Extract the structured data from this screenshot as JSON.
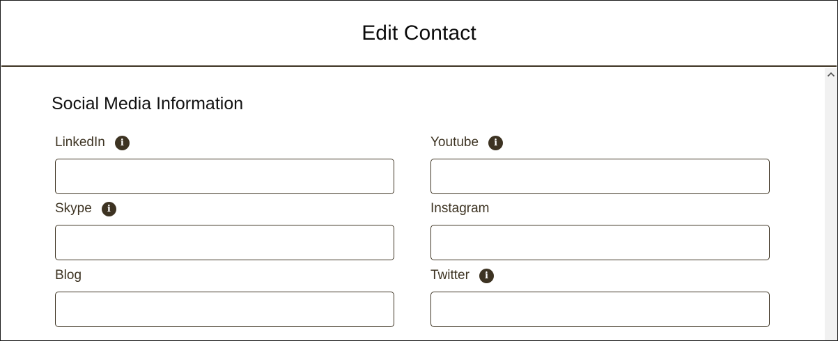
{
  "modal": {
    "title": "Edit Contact"
  },
  "section": {
    "heading": "Social Media Information"
  },
  "fields": {
    "linkedin": {
      "label": "LinkedIn",
      "value": "",
      "has_info": true
    },
    "youtube": {
      "label": "Youtube",
      "value": "",
      "has_info": true
    },
    "skype": {
      "label": "Skype",
      "value": "",
      "has_info": true
    },
    "instagram": {
      "label": "Instagram",
      "value": "",
      "has_info": false
    },
    "blog": {
      "label": "Blog",
      "value": "",
      "has_info": false
    },
    "twitter": {
      "label": "Twitter",
      "value": "",
      "has_info": true
    }
  },
  "icons": {
    "info": "info-icon",
    "scroll_up": "chevron-up-icon"
  },
  "colors": {
    "accent": "#3d3322",
    "border": "#3d3322",
    "scrollbar_track": "#f1f1f1"
  }
}
